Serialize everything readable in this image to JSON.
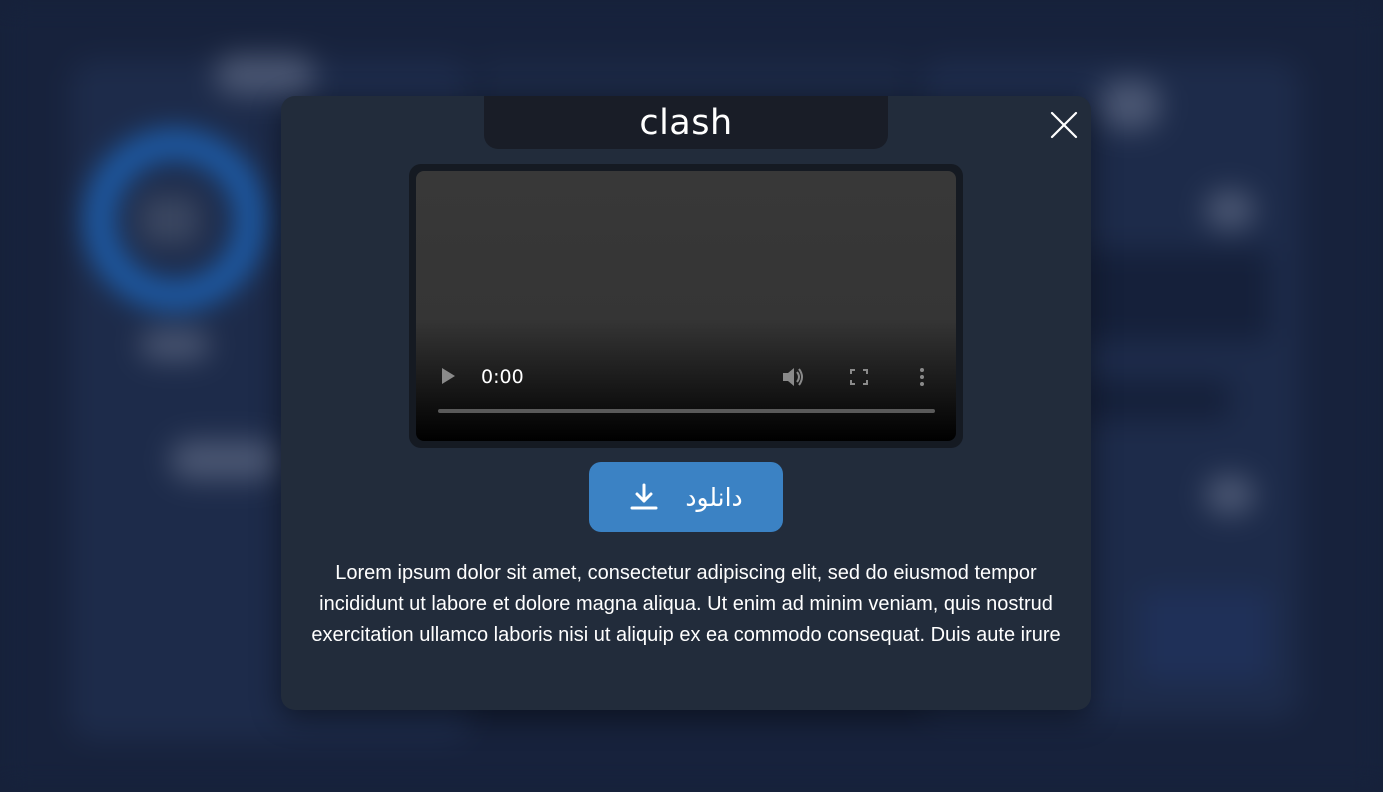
{
  "modal": {
    "title": "clash",
    "close_icon": "close-icon",
    "video": {
      "time": "0:00",
      "progress_fraction": 0.0,
      "controls": [
        "play-icon",
        "volume-icon",
        "fullscreen-icon",
        "more-vert-icon"
      ]
    },
    "download": {
      "label": "دانلود",
      "icon": "download-icon",
      "color": "#3b82c4"
    },
    "description": "Lorem ipsum dolor sit amet, consectetur adipiscing elit, sed do eiusmod tempor incididunt ut labore et dolore magna aliqua. Ut enim ad minim veniam, quis nostrud exercitation ullamco laboris nisi ut aliquip ex ea commodo consequat. Duis aute irure"
  }
}
